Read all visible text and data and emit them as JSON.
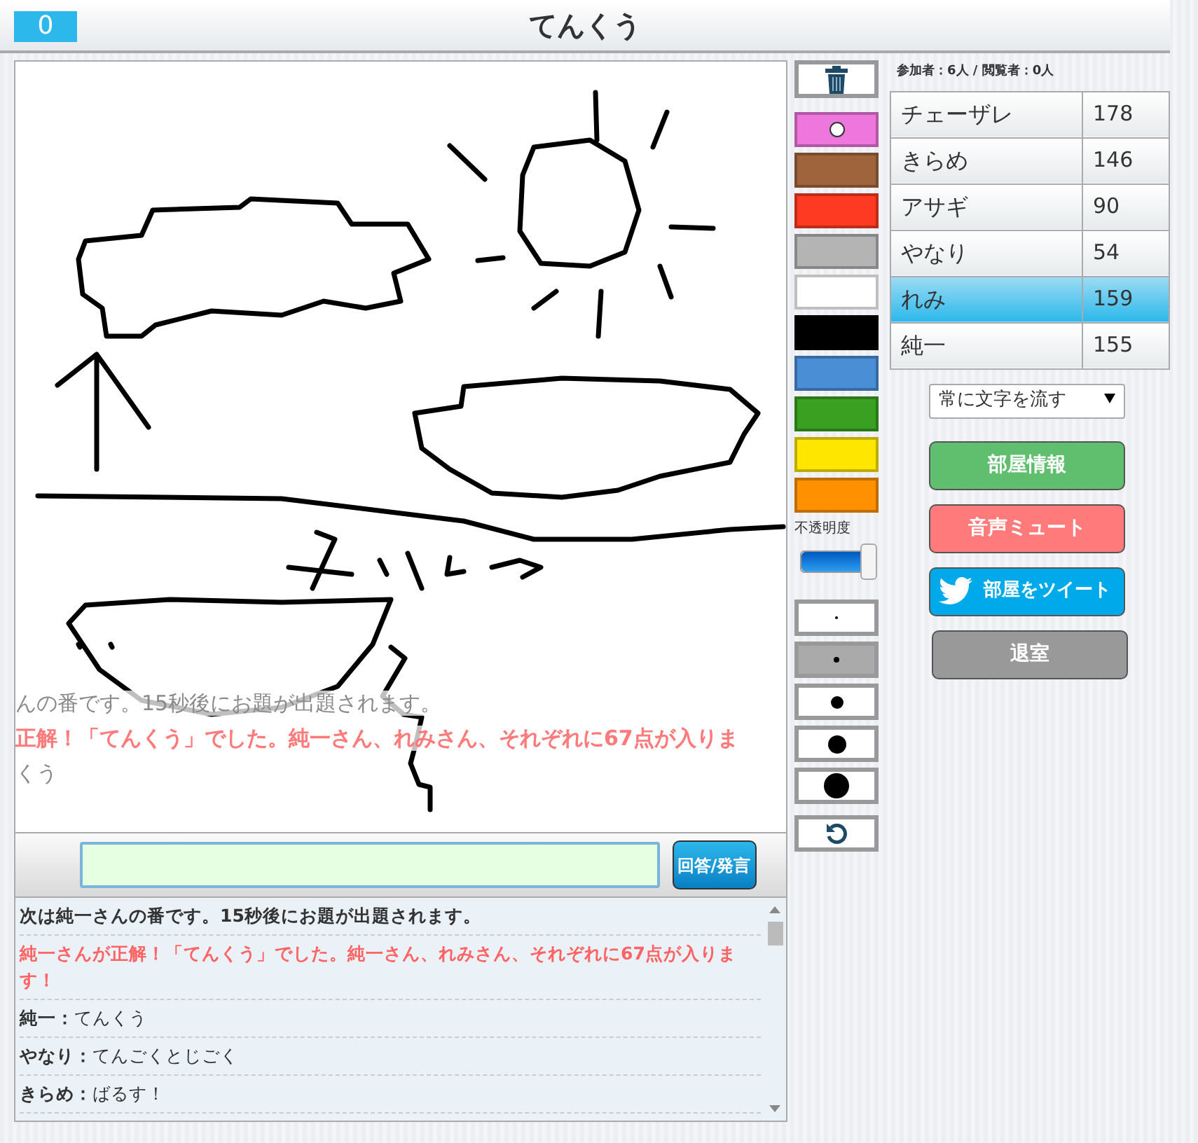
{
  "header": {
    "score": "0",
    "title": "てんくう"
  },
  "canvas": {
    "overlay_messages": [
      {
        "kind": "system",
        "text": "んの番です。15秒後にお題が出題されます。"
      },
      {
        "kind": "correct",
        "text": "正解！「てんくう」でした。純一さん、れみさん、それぞれに67点が入りま"
      },
      {
        "kind": "chat",
        "text": "くう"
      }
    ]
  },
  "tools": {
    "palette": [
      {
        "color": "#ee77dd",
        "selected": true
      },
      {
        "color": "#a0643c",
        "selected": false
      },
      {
        "color": "#ff3a22",
        "selected": false
      },
      {
        "color": "#b4b4b4",
        "selected": false
      },
      {
        "color": "#ffffff",
        "selected": false
      },
      {
        "color": "#000000",
        "selected": false
      },
      {
        "color": "#4a8ed6",
        "selected": false
      },
      {
        "color": "#3aa022",
        "selected": false
      },
      {
        "color": "#ffe600",
        "selected": false
      },
      {
        "color": "#ff9000",
        "selected": false
      }
    ],
    "opacity": {
      "label": "不透明度",
      "level": 0.93
    },
    "brush_sizes": [
      {
        "selected": false
      },
      {
        "selected": true
      },
      {
        "selected": false
      },
      {
        "selected": false
      },
      {
        "selected": false
      }
    ]
  },
  "participants": "参加者：6人 / 閲覧者：0人",
  "scoreboard": [
    {
      "name": "チェーザレ",
      "score": "178",
      "selected": false
    },
    {
      "name": "きらめ",
      "score": "146",
      "selected": false
    },
    {
      "name": "アサギ",
      "score": "90",
      "selected": false
    },
    {
      "name": "やなり",
      "score": "54",
      "selected": false
    },
    {
      "name": "れみ",
      "score": "159",
      "selected": true
    },
    {
      "name": "純一",
      "score": "155",
      "selected": false
    }
  ],
  "display_select": {
    "value": "常に文字を流す"
  },
  "buttons": [
    {
      "kind": "info",
      "label": "部屋情報"
    },
    {
      "kind": "mute",
      "label": "音声ミュート"
    },
    {
      "kind": "tweet",
      "label": "部屋をツイート"
    },
    {
      "kind": "leave",
      "label": "退室"
    }
  ],
  "chat": {
    "send_label": "回答/発言",
    "messages": [
      {
        "kind": "system",
        "text": "次は純一さんの番です。15秒後にお題が出題されます。"
      },
      {
        "kind": "correct",
        "text": "純一さんが正解！「てんくう」でした。純一さん、れみさん、それぞれに67点が入ります！"
      },
      {
        "kind": "chat",
        "speaker": "純一：",
        "text": "てんくう"
      },
      {
        "kind": "chat",
        "speaker": "やなり：",
        "text": "てんごくとじごく"
      },
      {
        "kind": "chat",
        "speaker": "きらめ：",
        "text": "ばるす！"
      }
    ]
  }
}
